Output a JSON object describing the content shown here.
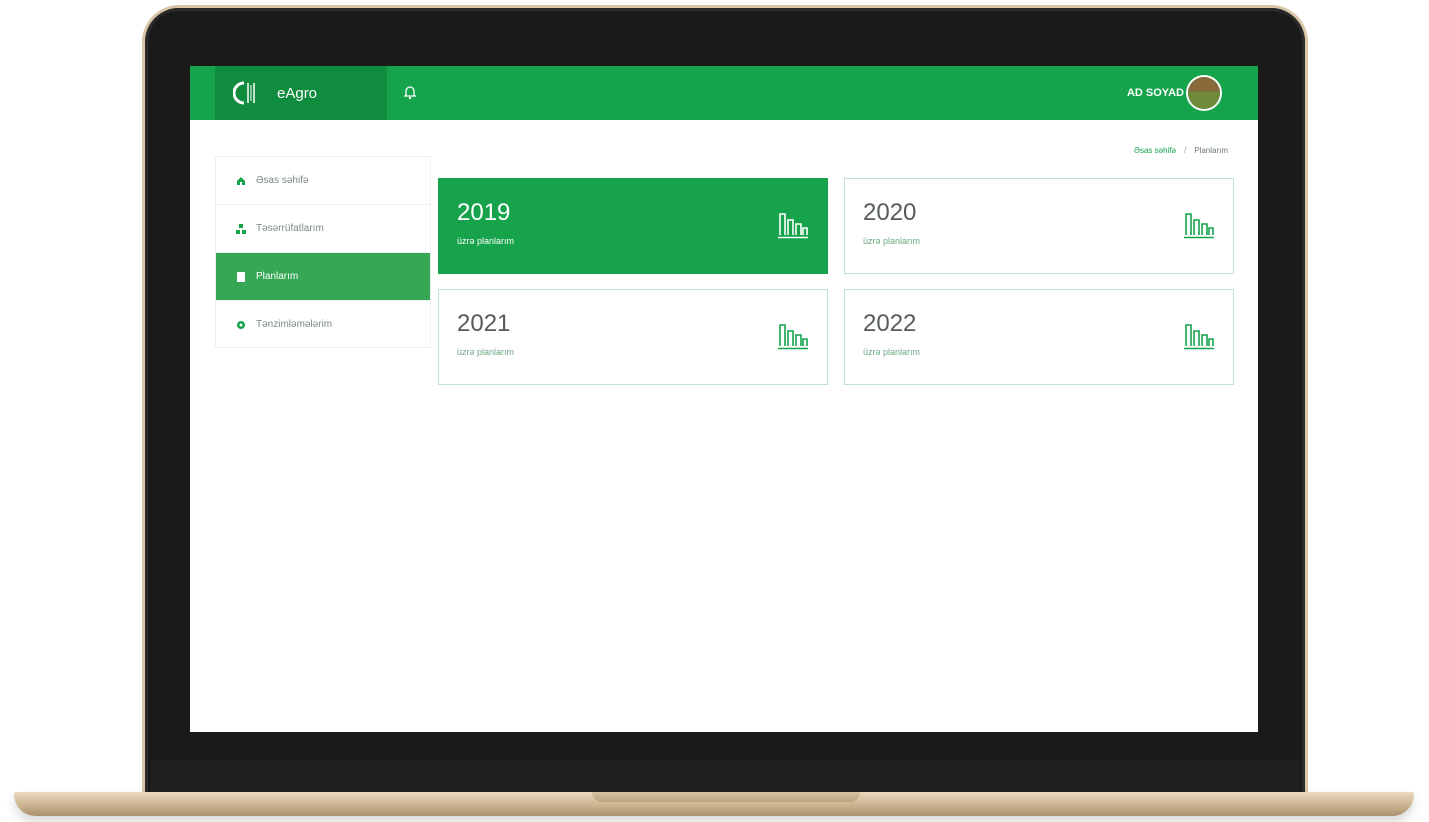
{
  "app": {
    "name": "eAgro"
  },
  "user": {
    "name": "AD SOYAD"
  },
  "breadcrumb": {
    "home": "Əsas səhifə",
    "separator": "/",
    "current": "Planlarım"
  },
  "sidebar": {
    "items": [
      {
        "label": "Əsas səhifə",
        "icon": "home-icon",
        "active": false
      },
      {
        "label": "Təsərrüfatlarım",
        "icon": "farms-icon",
        "active": false
      },
      {
        "label": "Planlarım",
        "icon": "plans-icon",
        "active": true
      },
      {
        "label": "Tənzimləmələrim",
        "icon": "settings-icon",
        "active": false
      }
    ]
  },
  "cards": [
    {
      "year": "2019",
      "subtitle": "üzrə planlarım",
      "active": true,
      "icon": "bar-chart-icon"
    },
    {
      "year": "2020",
      "subtitle": "üzrə planlarım",
      "active": false,
      "icon": "bar-chart-icon"
    },
    {
      "year": "2021",
      "subtitle": "üzrə planlarım",
      "active": false,
      "icon": "bar-chart-icon"
    },
    {
      "year": "2022",
      "subtitle": "üzrə planlarım",
      "active": false,
      "icon": "bar-chart-icon"
    }
  ],
  "colors": {
    "primary": "#15a44c",
    "brand_dark": "#108c3f",
    "active_item": "#36a855"
  }
}
